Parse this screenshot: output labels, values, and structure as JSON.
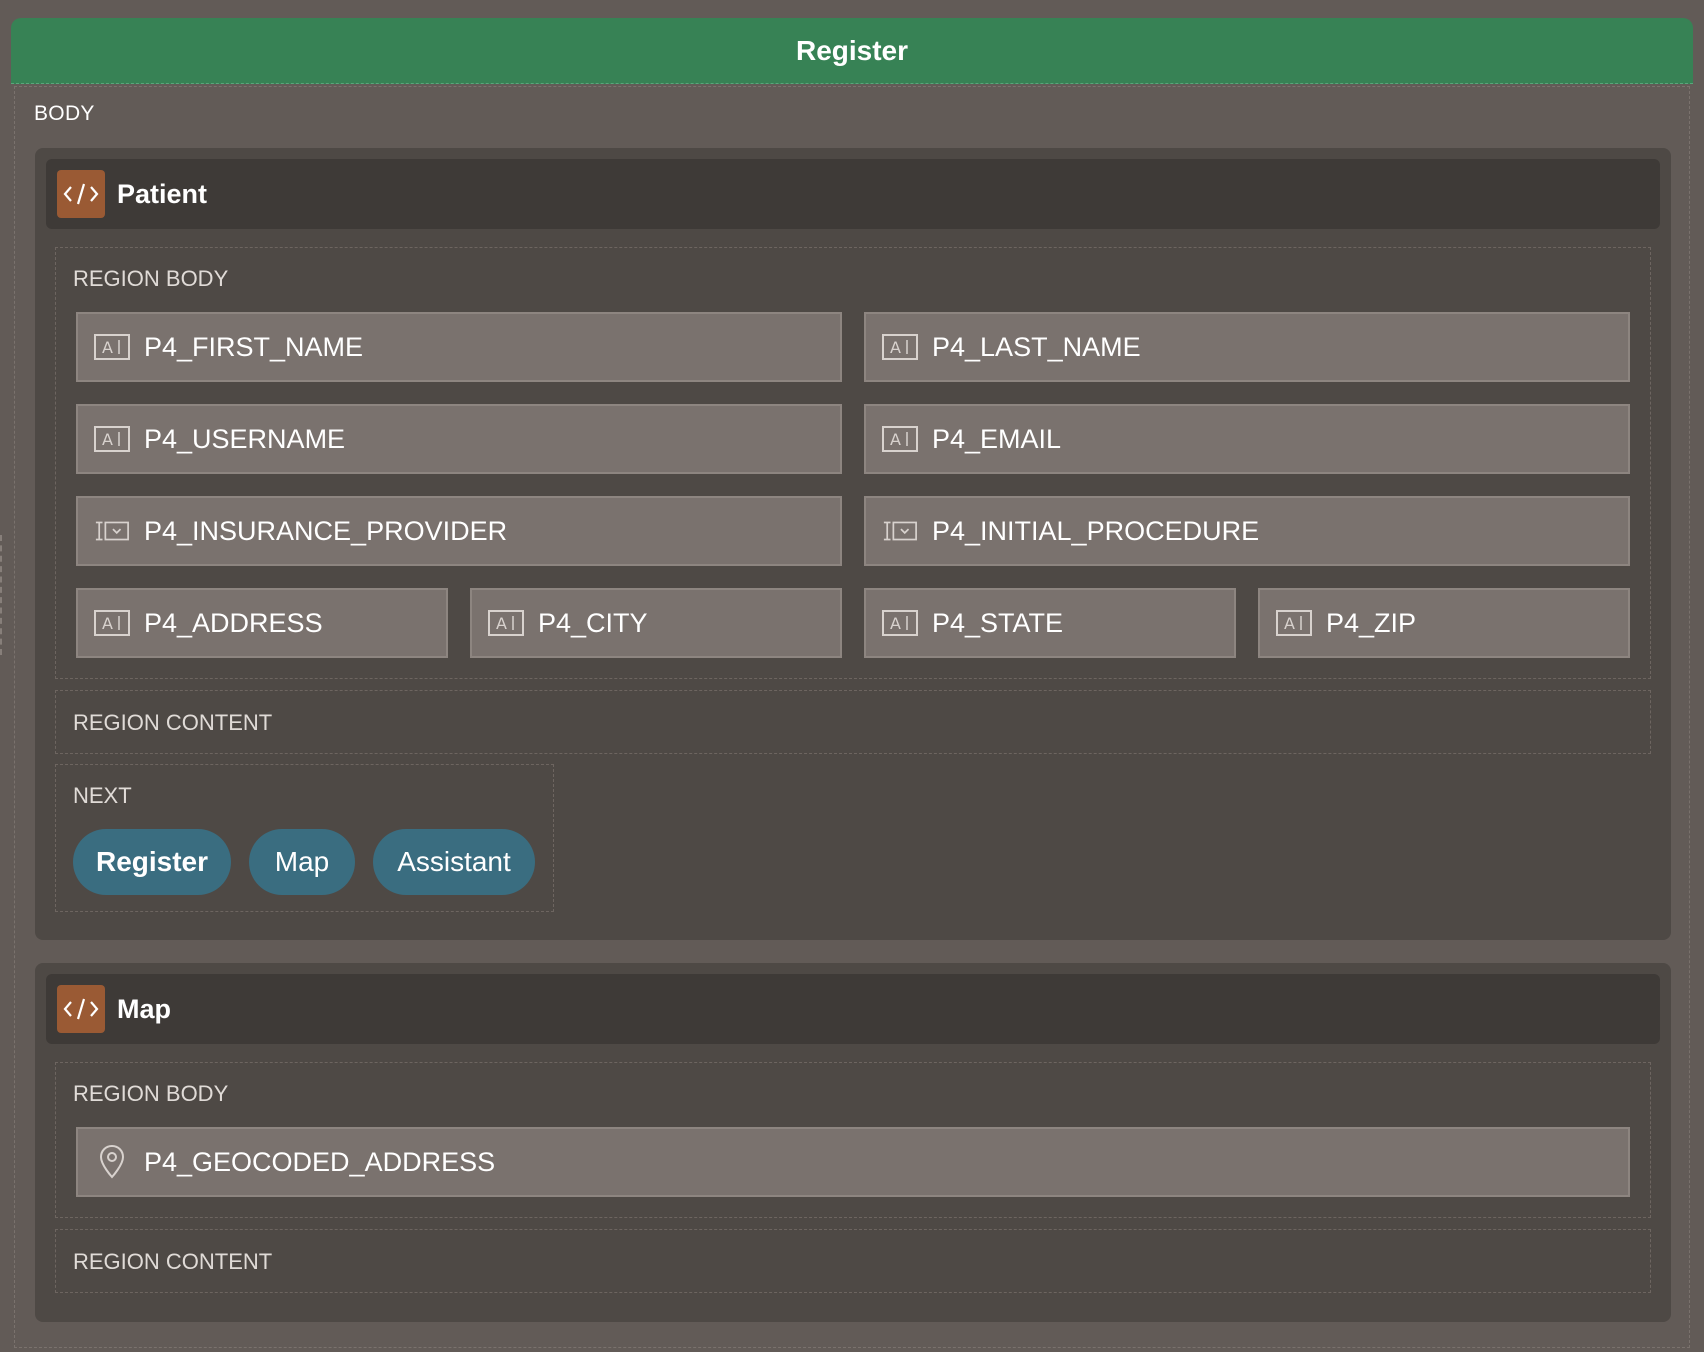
{
  "page": {
    "title": "Register",
    "body_label": "BODY"
  },
  "regions": [
    {
      "title": "Patient",
      "icon": "code-icon",
      "body_label": "REGION BODY",
      "items": [
        {
          "name": "P4_FIRST_NAME",
          "icon": "text-field-icon"
        },
        {
          "name": "P4_LAST_NAME",
          "icon": "text-field-icon"
        },
        {
          "name": "P4_USERNAME",
          "icon": "text-field-icon"
        },
        {
          "name": "P4_EMAIL",
          "icon": "text-field-icon"
        },
        {
          "name": "P4_INSURANCE_PROVIDER",
          "icon": "select-list-icon"
        },
        {
          "name": "P4_INITIAL_PROCEDURE",
          "icon": "select-list-icon"
        },
        {
          "name": "P4_ADDRESS",
          "icon": "text-field-icon"
        },
        {
          "name": "P4_CITY",
          "icon": "text-field-icon"
        },
        {
          "name": "P4_STATE",
          "icon": "text-field-icon"
        },
        {
          "name": "P4_ZIP",
          "icon": "text-field-icon"
        }
      ],
      "content_label": "REGION CONTENT",
      "next_label": "NEXT",
      "buttons": [
        {
          "label": "Register",
          "hot": true
        },
        {
          "label": "Map",
          "hot": false
        },
        {
          "label": "Assistant",
          "hot": false
        }
      ]
    },
    {
      "title": "Map",
      "icon": "code-icon",
      "body_label": "REGION BODY",
      "items": [
        {
          "name": "P4_GEOCODED_ADDRESS",
          "icon": "map-pin-icon"
        }
      ],
      "content_label": "REGION CONTENT"
    }
  ],
  "colors": {
    "title_bar": "#378255",
    "background": "#625b57",
    "region": "#4e4945",
    "region_header": "#3e3a37",
    "region_icon": "#9a5a34",
    "item": "#7a726e",
    "button": "#3a6d80"
  }
}
